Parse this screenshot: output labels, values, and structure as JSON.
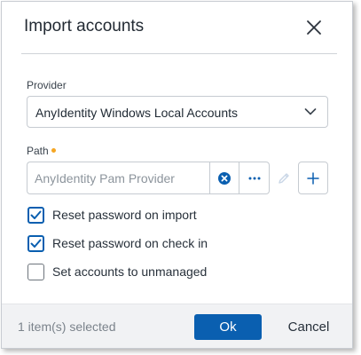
{
  "dialog": {
    "title": "Import accounts"
  },
  "provider": {
    "label": "Provider",
    "value": "AnyIdentity Windows Local Accounts"
  },
  "path": {
    "label": "Path",
    "placeholder": "AnyIdentity Pam Provider",
    "value": ""
  },
  "options": [
    {
      "label": "Reset password on import",
      "checked": true
    },
    {
      "label": "Reset password on check in",
      "checked": true
    },
    {
      "label": "Set accounts to unmanaged",
      "checked": false
    }
  ],
  "footer": {
    "status": "1 item(s) selected",
    "ok_label": "Ok",
    "cancel_label": "Cancel"
  },
  "icons": {
    "close": "close-icon",
    "chevron": "chevron-down-icon",
    "clear": "clear-circle-icon",
    "more": "more-horizontal-icon",
    "edit": "pencil-icon",
    "add": "plus-icon",
    "check": "checkmark-icon"
  },
  "colors": {
    "primary": "#0a5fb0",
    "required": "#f5a623",
    "disabled_icon": "#c9d6e6",
    "footer_bg": "#f1f2f4"
  }
}
